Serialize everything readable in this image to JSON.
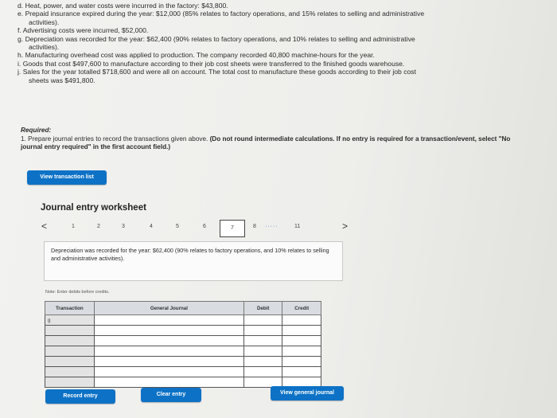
{
  "problem_items": [
    {
      "letter": "d.",
      "lines": [
        "Heat, power, and water costs were incurred in the factory: $43,800."
      ]
    },
    {
      "letter": "e.",
      "lines": [
        "Prepaid insurance expired during the year: $12,000 (85% relates to factory operations, and 15% relates to selling and administrative",
        "activities)."
      ]
    },
    {
      "letter": "f.",
      "lines": [
        "Advertising costs were incurred, $52,000."
      ]
    },
    {
      "letter": "g.",
      "lines": [
        "Depreciation was recorded for the year: $62,400 (90% relates to factory operations, and 10% relates to selling and administrative",
        "activities)."
      ]
    },
    {
      "letter": "h.",
      "lines": [
        "Manufacturing overhead cost was applied to production. The company recorded 40,800 machine-hours for the year."
      ]
    },
    {
      "letter": "i.",
      "lines": [
        "Goods that cost $497,600 to manufacture according to their job cost sheets were transferred to the finished goods warehouse."
      ]
    },
    {
      "letter": "j.",
      "lines": [
        "Sales for the year totalled $718,600 and were all on account. The total cost to manufacture these goods according to their job cost",
        "sheets was $491,800."
      ]
    }
  ],
  "required": {
    "heading": "Required:",
    "text_plain": "1. Prepare journal entries to record the transactions given above. ",
    "text_bold": "(Do not round intermediate calculations. If no entry is required for a transaction/event, select \"No journal entry required\" in the first account field.)"
  },
  "buttons": {
    "view_transactions": "View transaction list",
    "record_entry": "Record entry",
    "clear_entry": "Clear entry",
    "view_general_journal": "View general journal"
  },
  "worksheet": {
    "title": "Journal entry worksheet",
    "pages": [
      "1",
      "2",
      "3",
      "4",
      "5",
      "6",
      "7",
      "8",
      "11"
    ],
    "ellipsis": "·····",
    "current_page": "7",
    "prev_arrow": "<",
    "next_arrow": ">",
    "description": "Depreciation was recorded for the year: $62,400 (90% relates to factory operations, and 10% relates to selling and administrative activities).",
    "note": "Note: Enter debits before credits."
  },
  "journal_table": {
    "headers": {
      "transaction": "Transaction",
      "general_journal": "General Journal",
      "debit": "Debit",
      "credit": "Credit"
    },
    "first_transaction": "g"
  }
}
